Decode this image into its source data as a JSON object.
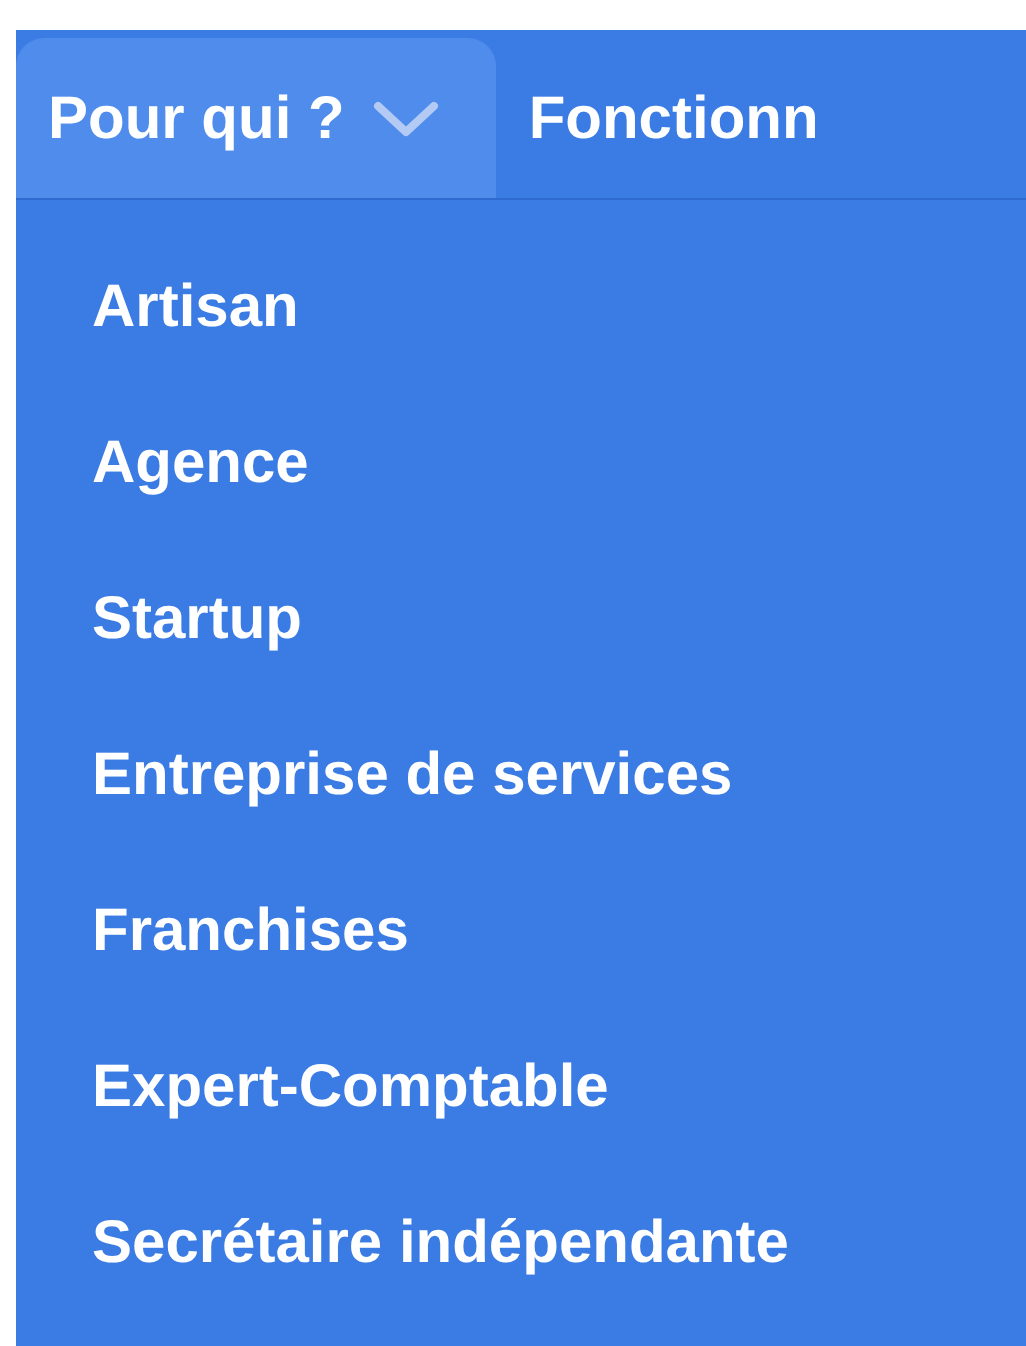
{
  "nav": [
    {
      "label": "Pour qui ?",
      "kind": "dropdown",
      "expanded": true
    },
    {
      "label": "Fonctionn",
      "kind": "link",
      "expanded": false
    }
  ],
  "menu": [
    {
      "label": "Artisan"
    },
    {
      "label": "Agence"
    },
    {
      "label": "Startup"
    },
    {
      "label": "Entreprise de services"
    },
    {
      "label": "Franchises"
    },
    {
      "label": "Expert-Comptable"
    },
    {
      "label": "Secrétaire indépendante"
    }
  ]
}
